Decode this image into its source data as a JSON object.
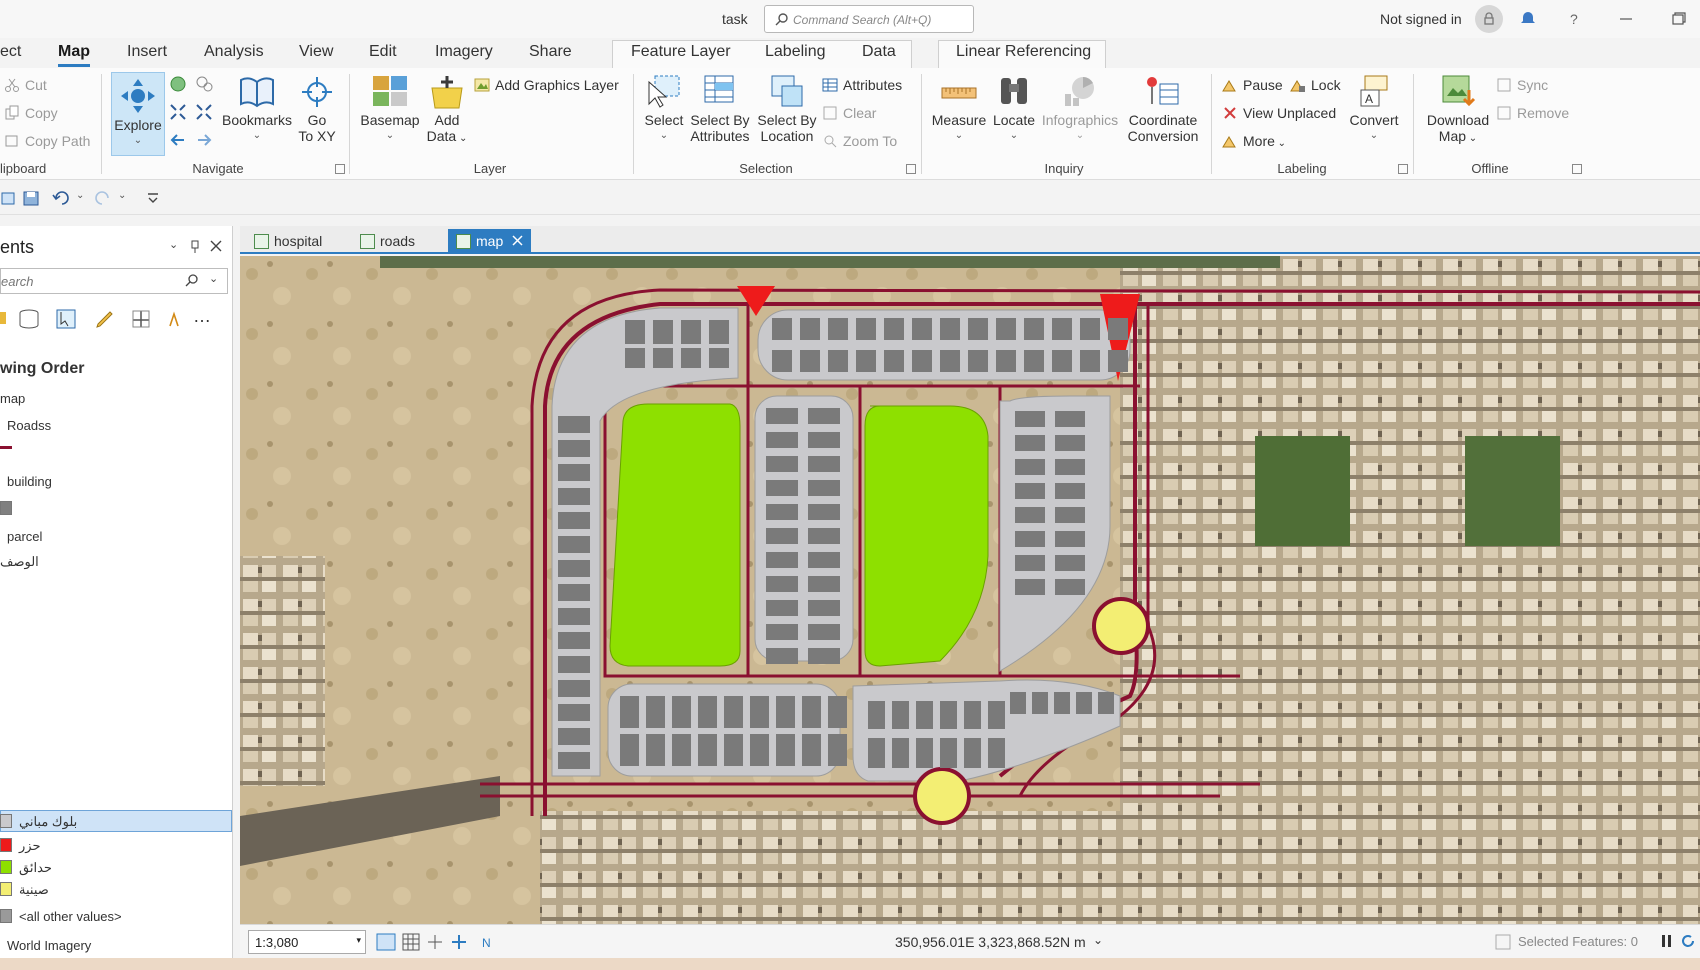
{
  "titlebar": {
    "project": "task",
    "command_search_placeholder": "Command Search (Alt+Q)",
    "signin": "Not signed in"
  },
  "ribbon_tabs": {
    "project": "ect",
    "map": "Map",
    "insert": "Insert",
    "analysis": "Analysis",
    "view": "View",
    "edit": "Edit",
    "imagery": "Imagery",
    "share": "Share",
    "feature_layer": "Feature Layer",
    "labeling": "Labeling",
    "data": "Data",
    "linear_referencing": "Linear Referencing"
  },
  "clipboard": {
    "cut": "Cut",
    "copy": "Copy",
    "copy_path": "Copy Path",
    "label": "lipboard"
  },
  "navigate": {
    "explore": "Explore",
    "bookmarks": "Bookmarks",
    "go": "Go",
    "to_xy": "To XY",
    "label": "Navigate"
  },
  "layer": {
    "basemap": "Basemap",
    "add": "Add",
    "data": "Data",
    "add_graphics": "Add Graphics Layer",
    "label": "Layer"
  },
  "selection": {
    "select": "Select",
    "select_by": "Select By",
    "attributes": "Attributes",
    "location": "Location",
    "attributes_btn": "Attributes",
    "clear": "Clear",
    "zoom_to": "Zoom To",
    "label": "Selection"
  },
  "inquiry": {
    "measure": "Measure",
    "locate": "Locate",
    "infographics": "Infographics",
    "coordinate": "Coordinate",
    "conversion": "Conversion",
    "label": "Inquiry"
  },
  "labeling_group": {
    "pause": "Pause",
    "lock": "Lock",
    "view_unplaced": "View Unplaced",
    "more": "More",
    "convert": "Convert",
    "label": "Labeling"
  },
  "offline": {
    "download": "Download",
    "map": "Map",
    "sync": "Sync",
    "remove": "Remove",
    "label": "Offline"
  },
  "contents": {
    "title": "ents",
    "search_placeholder": "earch",
    "drawing_order": "wing Order",
    "map": "map",
    "roadss": "Roadss",
    "building": "building",
    "parcel": "parcel",
    "field": "الوصف",
    "cats": [
      "بلوك مباني",
      "حزر",
      "حدائق",
      "صينية"
    ],
    "other": "<all other values>",
    "world_imagery": "World Imagery"
  },
  "colors": {
    "road": "#8a1030",
    "park": "#8ee000",
    "parcel": "#c9c9cc",
    "building": "#7a7a7a",
    "island": "#f3ee73",
    "red": "#ee1b1b",
    "accent": "#2d7cc1"
  },
  "map_tabs": [
    "hospital",
    "roads",
    "map"
  ],
  "status": {
    "scale": "1:3,080",
    "coords": "350,956.01E 3,323,868.52N m",
    "selected": "Selected Features: 0"
  }
}
